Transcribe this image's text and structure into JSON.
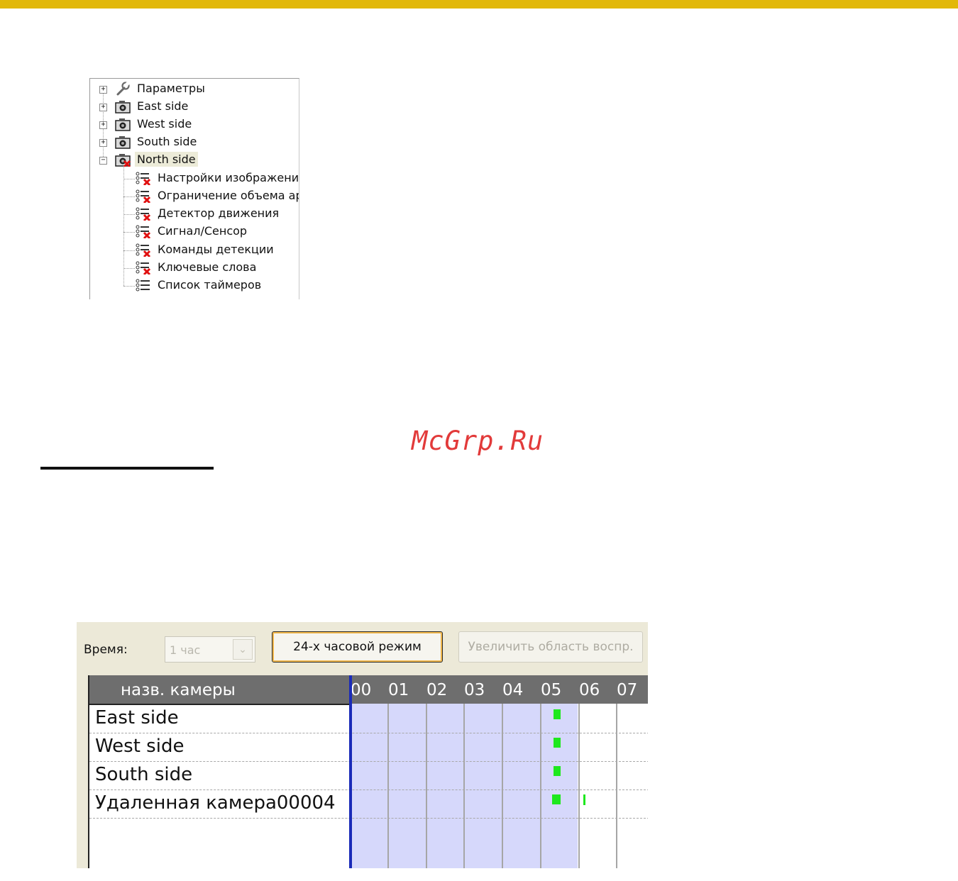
{
  "colors": {
    "accent_bar": "#e2b80a",
    "watermark": "#e23a3a",
    "recording_mark": "#1ee81e",
    "playback_cursor": "#1a2bb8",
    "shaded_range": "#d6d8fb"
  },
  "tree": {
    "nodes": [
      {
        "label": "Параметры",
        "icon": "wrench-icon",
        "state": "collapsed"
      },
      {
        "label": "East side",
        "icon": "camera-icon",
        "state": "collapsed"
      },
      {
        "label": "West side",
        "icon": "camera-icon",
        "state": "collapsed"
      },
      {
        "label": "South side",
        "icon": "camera-icon",
        "state": "collapsed"
      },
      {
        "label": "North side",
        "icon": "camera-error-icon",
        "state": "expanded",
        "selected": true,
        "children": [
          {
            "label": "Настройки изображения",
            "icon": "settings-list-error-icon"
          },
          {
            "label": "Ограничение объема архи",
            "icon": "settings-list-error-icon"
          },
          {
            "label": "Детектор движения",
            "icon": "settings-list-error-icon"
          },
          {
            "label": "Сигнал/Сенсор",
            "icon": "settings-list-error-icon"
          },
          {
            "label": "Команды детекции",
            "icon": "settings-list-error-icon"
          },
          {
            "label": "Ключевые слова",
            "icon": "settings-list-error-icon"
          },
          {
            "label": "Список таймеров",
            "icon": "settings-list-icon"
          }
        ]
      }
    ]
  },
  "watermark": "McGrp.Ru",
  "timeline": {
    "time_label": "Время:",
    "time_select": {
      "value": "1 час",
      "disabled": true
    },
    "mode_button": "24-х часовой режим",
    "zoom_button": {
      "label": "Увеличить область воспр.",
      "disabled": true
    },
    "camera_header": "назв. камеры",
    "hours": [
      "00",
      "01",
      "02",
      "03",
      "04",
      "05",
      "06",
      "07"
    ],
    "cameras": [
      "East side",
      "West side",
      "South side",
      "Удаленная камера00004"
    ]
  }
}
